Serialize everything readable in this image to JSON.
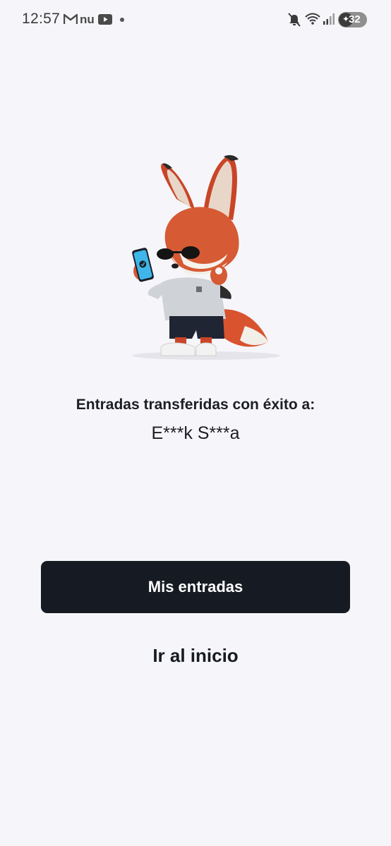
{
  "status_bar": {
    "time": "12:57",
    "notification_app_label": "nu",
    "battery_level": "32",
    "icons": [
      "gmail-icon",
      "nu-icon",
      "youtube-icon",
      "notification-dot-icon",
      "mute-icon",
      "wifi-icon",
      "signal-icon",
      "battery-icon"
    ]
  },
  "illustration": {
    "name": "fox-mascot-with-phone"
  },
  "confirmation": {
    "message": "Entradas transferidas con éxito a:",
    "recipient": "E***k S***a"
  },
  "actions": {
    "primary_label": "Mis entradas",
    "secondary_label": "Ir al inicio"
  },
  "colors": {
    "background": "#f6f6fa",
    "primary_button": "#161a22",
    "primary_text": "#ffffff",
    "text": "#1c1e24"
  }
}
